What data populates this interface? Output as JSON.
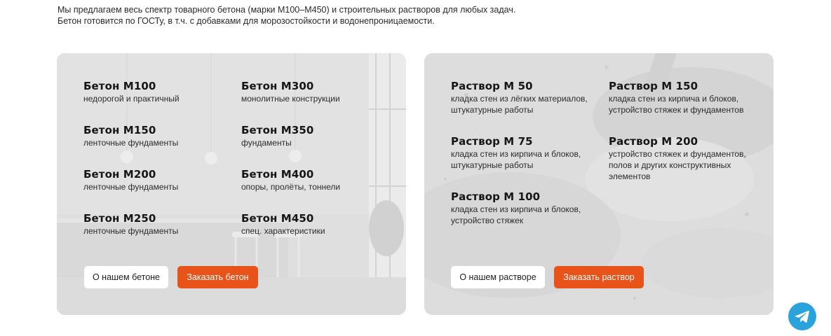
{
  "intro": {
    "line1": "Мы предлагаем весь спектр товарного бетона (марки М100–М450) и строительных растворов для любых задач.",
    "line2": "Бетон готовится по ГОСТу, в т.ч. с добавками для морозостойкости и водонепроницаемости."
  },
  "concrete": {
    "items": [
      {
        "title": "Бетон М100",
        "desc": "недорогой и практичный"
      },
      {
        "title": "Бетон М300",
        "desc": "монолитные конструкции"
      },
      {
        "title": "Бетон М150",
        "desc": "ленточные фундаменты"
      },
      {
        "title": "Бетон М350",
        "desc": "фундаменты"
      },
      {
        "title": "Бетон М200",
        "desc": "ленточные фундаменты"
      },
      {
        "title": "Бетон М400",
        "desc": "опоры, пролёты, тоннели"
      },
      {
        "title": "Бетон М250",
        "desc": "ленточные фундаменты"
      },
      {
        "title": "Бетон М450",
        "desc": "спец. характеристики"
      }
    ],
    "about_label": "О нашем бетоне",
    "order_label": "Заказать бетон"
  },
  "mortar": {
    "items": [
      {
        "title": "Раствор М 50",
        "desc": "кладка стен из лёгких материалов, штукатурные работы"
      },
      {
        "title": "Раствор М 150",
        "desc": "кладка стен из кирпича и блоков, устройство стяжек и фундаментов"
      },
      {
        "title": "Раствор М 75",
        "desc": "кладка стен из кирпича и блоков, штукатурные работы"
      },
      {
        "title": "Раствор М 200",
        "desc": "устройство стяжек и фундаментов, полов и других конструктивных элементов"
      },
      {
        "title": "Раствор М 100",
        "desc": "кладка стен из кирпича и блоков, устройство стяжек"
      }
    ],
    "about_label": "О нашем растворе",
    "order_label": "Заказать раствор"
  },
  "colors": {
    "accent": "#e8531a",
    "telegram": "#2aa3dc"
  },
  "icons": {
    "floating": "telegram-icon"
  }
}
